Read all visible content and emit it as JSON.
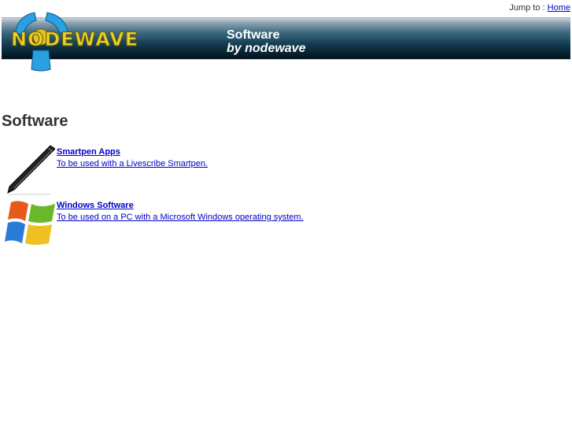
{
  "header": {
    "jump_label": "Jump to :",
    "jump_link": "Home",
    "logo_text": "NODEWAVE",
    "tagline1": "Software",
    "tagline2": "by nodewave"
  },
  "page_title": "Software",
  "items": [
    {
      "title": "Smartpen Apps",
      "description": "To be used with a Livescribe Smartpen.",
      "icon": "pen-icon"
    },
    {
      "title": "Windows Software",
      "description": "To be used on a PC with a Microsoft Windows operating system.",
      "icon": "windows-logo-icon"
    }
  ]
}
